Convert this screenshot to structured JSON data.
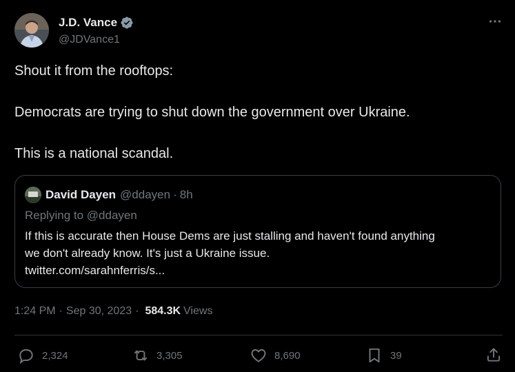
{
  "author": {
    "name": "J.D. Vance",
    "handle": "@JDVance1",
    "verified": true,
    "verified_color": "#8899a6"
  },
  "tweet": {
    "lines": [
      "Shout it from the rooftops:",
      "Democrats are trying to shut down the government over Ukraine.",
      "This is a national scandal."
    ]
  },
  "quote": {
    "name": "David Dayen",
    "handle": "@ddayen",
    "dot": "·",
    "time": "8h",
    "replying_to": "Replying to @ddayen",
    "text_lines": [
      "If this is accurate then House Dems are just stalling and haven't found anything",
      "we don't already know. It's just a Ukraine issue.",
      "twitter.com/sarahnferris/s..."
    ]
  },
  "meta": {
    "time": "1:24 PM",
    "sep": "·",
    "date": "Sep 30, 2023",
    "views_count": "584.3K",
    "views_label": "Views"
  },
  "actions": {
    "replies": "2,324",
    "retweets": "3,305",
    "likes": "8,690",
    "bookmarks": "39"
  },
  "icons": {
    "more": "more-dots-icon",
    "reply": "reply-bubble-icon",
    "retweet": "retweet-icon",
    "like": "heart-icon",
    "bookmark": "bookmark-icon",
    "share": "share-upload-icon"
  }
}
